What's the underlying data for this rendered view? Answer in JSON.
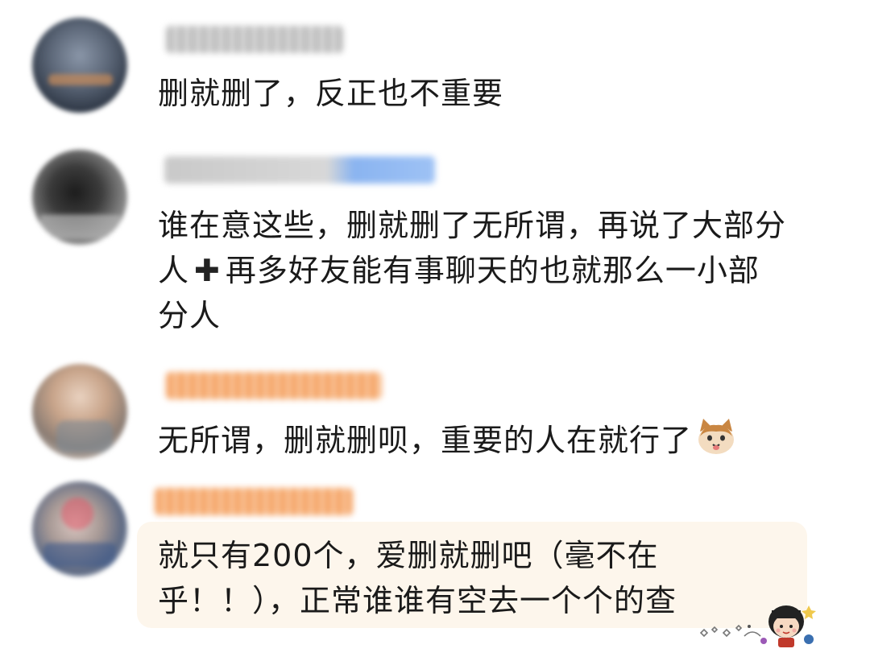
{
  "comments": [
    {
      "username_hidden": true,
      "lines": [
        "删就删了，反正也不重要"
      ]
    },
    {
      "username_hidden": true,
      "lines": [
        "谁在意这些，删就删了无所谓，再说了大部分",
        "再多好友能有事聊天的也就那么一小部",
        "分人"
      ],
      "line2_prefix": "人",
      "plus_icon": "heavy-plus-icon"
    },
    {
      "username_hidden": true,
      "lines": [
        "无所谓，删就删呗，重要的人在就行了"
      ],
      "emoji": "cat-face-icon"
    },
    {
      "username_hidden": true,
      "lines": [
        "就只有200个，爱删就删吧（毫不在",
        "乎！！），正常谁谁有空去一个个的查"
      ],
      "sticker": "maruko-sticker-icon"
    }
  ],
  "colors": {
    "text": "#1a1a1a",
    "highlight_bg": "#fdf6ec",
    "username_gray": "#c9c9c9",
    "username_blue": "#8ab4f0",
    "username_orange": "#f5a66a"
  }
}
